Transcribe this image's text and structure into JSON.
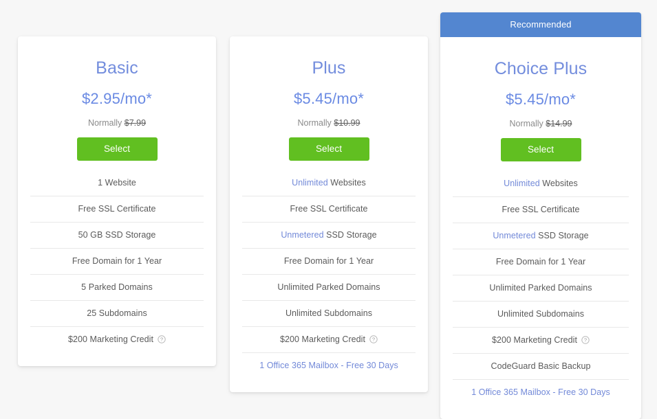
{
  "page": {
    "background_color": "#f7f7f7",
    "accent_blue": "#7289d8",
    "banner_blue": "#5386d0",
    "button_green": "#61bf21"
  },
  "plans": [
    {
      "id": "basic",
      "name": "Basic",
      "price": "$2.95/mo*",
      "normally_label": "Normally",
      "normally_price": "$7.99",
      "select_label": "Select",
      "recommended": false,
      "features": [
        {
          "prefix": "",
          "text": "1 Website",
          "highlight": "none",
          "help": false
        },
        {
          "prefix": "",
          "text": "Free SSL Certificate",
          "highlight": "none",
          "help": false
        },
        {
          "prefix": "",
          "text": "50 GB SSD Storage",
          "highlight": "none",
          "help": false
        },
        {
          "prefix": "",
          "text": "Free Domain for 1 Year",
          "highlight": "none",
          "help": false
        },
        {
          "prefix": "",
          "text": "5 Parked Domains",
          "highlight": "none",
          "help": false
        },
        {
          "prefix": "",
          "text": "25 Subdomains",
          "highlight": "none",
          "help": false
        },
        {
          "prefix": "",
          "text": "$200 Marketing Credit",
          "highlight": "none",
          "help": true
        }
      ]
    },
    {
      "id": "plus",
      "name": "Plus",
      "price": "$5.45/mo*",
      "normally_label": "Normally",
      "normally_price": "$10.99",
      "select_label": "Select",
      "recommended": false,
      "features": [
        {
          "prefix": "Unlimited",
          "text": " Websites",
          "highlight": "prefix",
          "help": false
        },
        {
          "prefix": "",
          "text": "Free SSL Certificate",
          "highlight": "none",
          "help": false
        },
        {
          "prefix": "Unmetered",
          "text": " SSD Storage",
          "highlight": "prefix",
          "help": false
        },
        {
          "prefix": "",
          "text": "Free Domain for 1 Year",
          "highlight": "none",
          "help": false
        },
        {
          "prefix": "",
          "text": "Unlimited Parked Domains",
          "highlight": "none",
          "help": false
        },
        {
          "prefix": "",
          "text": "Unlimited Subdomains",
          "highlight": "none",
          "help": false
        },
        {
          "prefix": "",
          "text": "$200 Marketing Credit",
          "highlight": "none",
          "help": true
        },
        {
          "prefix": "",
          "text": "1 Office 365 Mailbox - Free 30 Days",
          "highlight": "all",
          "help": false
        }
      ]
    },
    {
      "id": "choice-plus",
      "name": "Choice Plus",
      "price": "$5.45/mo*",
      "normally_label": "Normally",
      "normally_price": "$14.99",
      "select_label": "Select",
      "recommended": true,
      "recommended_label": "Recommended",
      "features": [
        {
          "prefix": "Unlimited",
          "text": " Websites",
          "highlight": "prefix",
          "help": false
        },
        {
          "prefix": "",
          "text": "Free SSL Certificate",
          "highlight": "none",
          "help": false
        },
        {
          "prefix": "Unmetered",
          "text": " SSD Storage",
          "highlight": "prefix",
          "help": false
        },
        {
          "prefix": "",
          "text": "Free Domain for 1 Year",
          "highlight": "none",
          "help": false
        },
        {
          "prefix": "",
          "text": "Unlimited Parked Domains",
          "highlight": "none",
          "help": false
        },
        {
          "prefix": "",
          "text": "Unlimited Subdomains",
          "highlight": "none",
          "help": false
        },
        {
          "prefix": "",
          "text": "$200 Marketing Credit",
          "highlight": "none",
          "help": true
        },
        {
          "prefix": "",
          "text": "CodeGuard Basic Backup",
          "highlight": "none",
          "help": false
        },
        {
          "prefix": "",
          "text": "1 Office 365 Mailbox - Free 30 Days",
          "highlight": "all",
          "help": false
        }
      ]
    }
  ],
  "icons": {
    "help": "help-circle-icon"
  }
}
